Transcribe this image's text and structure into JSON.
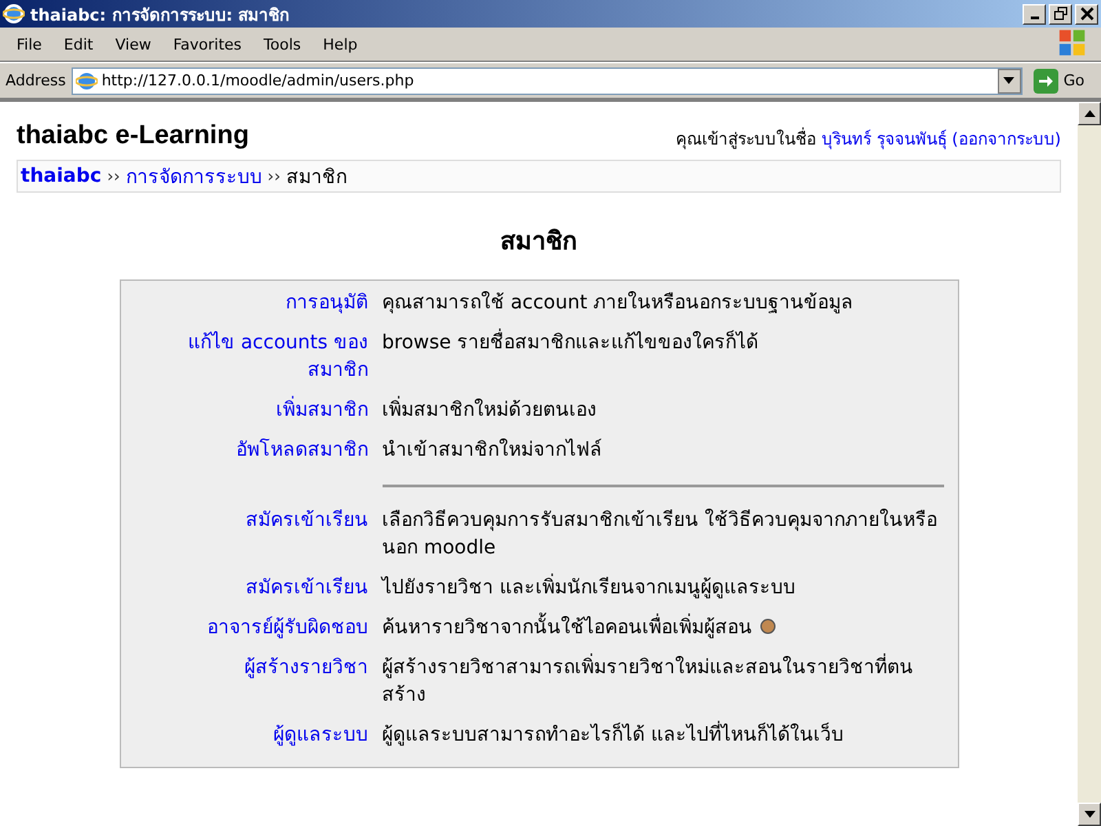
{
  "window": {
    "title": "thaiabc: การจัดการระบบ: สมาชิก"
  },
  "menu": [
    "File",
    "Edit",
    "View",
    "Favorites",
    "Tools",
    "Help"
  ],
  "address": {
    "label": "Address",
    "value": "http://127.0.0.1/moodle/admin/users.php",
    "go": "Go"
  },
  "site": {
    "name": "thaiabc e-Learning",
    "login_prefix": "คุณเข้าสู่ระบบในชื่อ",
    "user": "บุรินทร์ รุจจนพันธุ์",
    "logout": "(ออกจากระบบ)"
  },
  "breadcrumb": [
    {
      "label": "thaiabc",
      "link": true,
      "bold": true
    },
    {
      "label": "การจัดการระบบ",
      "link": true,
      "bold": false
    },
    {
      "label": "สมาชิก",
      "link": false,
      "bold": false
    }
  ],
  "breadcrumb_separator": "››",
  "heading": "สมาชิก",
  "rows": [
    {
      "kind": "item",
      "label": "การอนุมัติ",
      "text": "คุณสามารถใช้ account ภายในหรือนอกระบบฐานข้อมูล",
      "icon": false
    },
    {
      "kind": "item",
      "label": "แก้ไข accounts ของสมาชิก",
      "text": "browse รายชื่อสมาชิกและแก้ไขของใครก็ได้",
      "icon": false
    },
    {
      "kind": "item",
      "label": "เพิ่มสมาชิก",
      "text": "เพิ่มสมาชิกใหม่ด้วยตนเอง",
      "icon": false
    },
    {
      "kind": "item",
      "label": "อัพโหลดสมาชิก",
      "text": "นำเข้าสมาชิกใหม่จากไฟล์",
      "icon": false
    },
    {
      "kind": "divider"
    },
    {
      "kind": "item",
      "label": "สมัครเข้าเรียน",
      "text": "เลือกวิธีควบคุมการรับสมาชิกเข้าเรียน ใช้วิธีควบคุมจากภายในหรือนอก moodle",
      "icon": false
    },
    {
      "kind": "item",
      "label": "สมัครเข้าเรียน",
      "text": "ไปยังรายวิชา และเพิ่มนักเรียนจากเมนูผู้ดูแลระบบ",
      "icon": false
    },
    {
      "kind": "item",
      "label": "อาจารย์ผู้รับผิดชอบ",
      "text": "ค้นหารายวิชาจากนั้นใช้ไอคอนเพื่อเพิ่มผู้สอน",
      "icon": true
    },
    {
      "kind": "item",
      "label": "ผู้สร้างรายวิชา",
      "text": "ผู้สร้างรายวิชาสามารถเพิ่มรายวิชาใหม่และสอนในรายวิชาที่ตนสร้าง",
      "icon": false
    },
    {
      "kind": "item",
      "label": "ผู้ดูแลระบบ",
      "text": "ผู้ดูแลระบบสามารถทำอะไรก็ได้ และไปที่ไหนก็ได้ในเว็บ",
      "icon": false
    }
  ]
}
